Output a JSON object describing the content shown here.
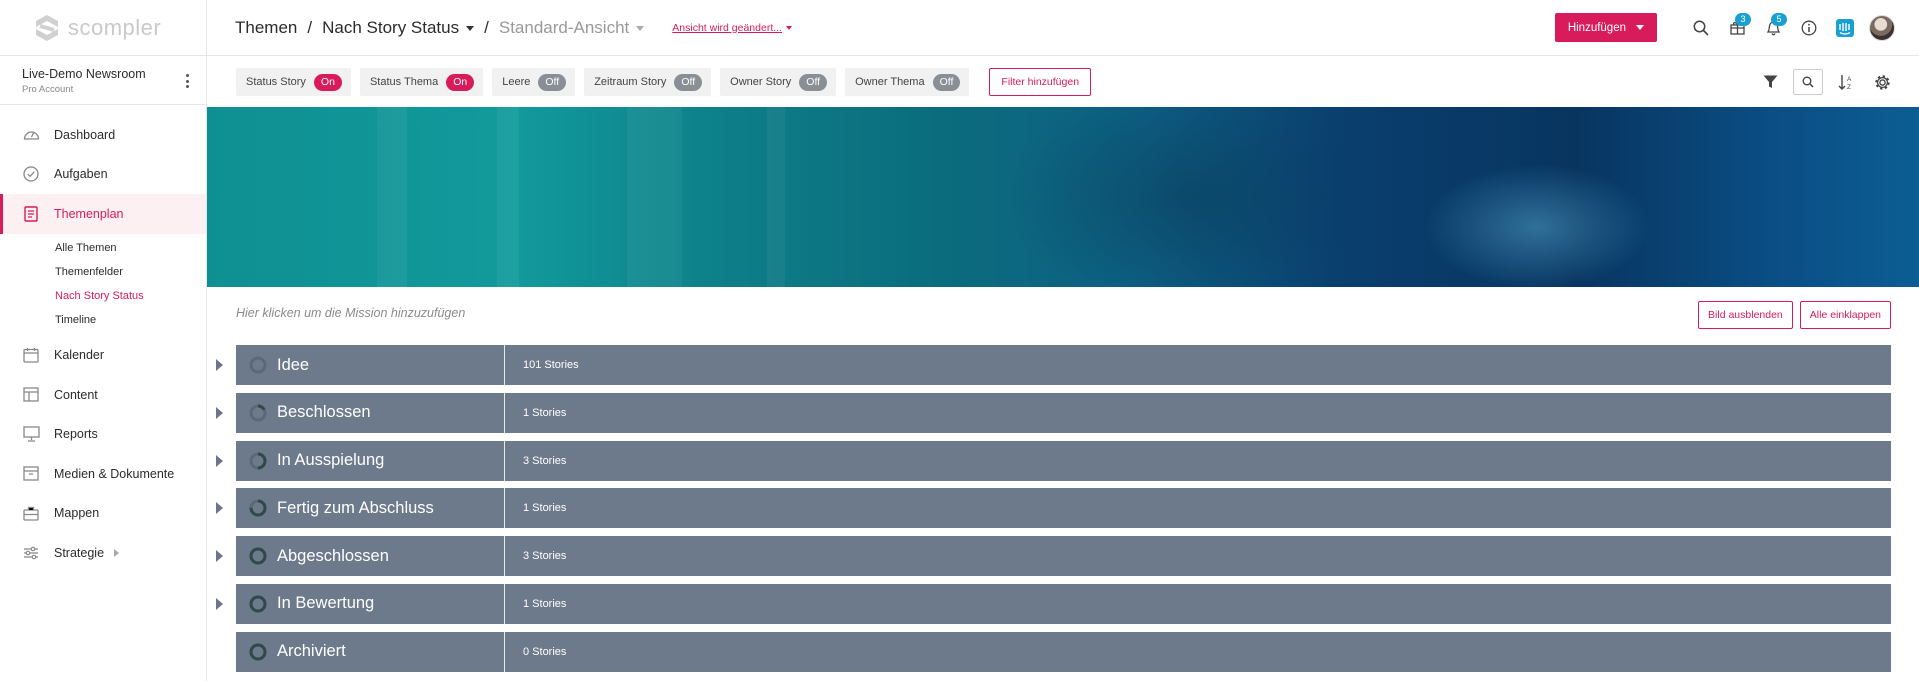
{
  "app": {
    "logo_text": "scompler"
  },
  "account": {
    "name": "Live-Demo Newsroom",
    "plan": "Pro Account"
  },
  "nav": {
    "items": [
      {
        "label": "Dashboard",
        "icon": "gauge-icon"
      },
      {
        "label": "Aufgaben",
        "icon": "check-circle-icon"
      },
      {
        "label": "Themenplan",
        "icon": "document-icon"
      },
      {
        "label": "Kalender",
        "icon": "calendar-icon"
      },
      {
        "label": "Content",
        "icon": "layout-icon"
      },
      {
        "label": "Reports",
        "icon": "monitor-icon"
      },
      {
        "label": "Medien & Dokumente",
        "icon": "archive-icon"
      },
      {
        "label": "Mappen",
        "icon": "briefcase-icon"
      },
      {
        "label": "Strategie",
        "icon": "sliders-icon"
      }
    ],
    "sub_items": [
      "Alle Themen",
      "Themenfelder",
      "Nach Story Status",
      "Timeline"
    ]
  },
  "header": {
    "crumb1": "Themen",
    "crumb2": "Nach Story Status",
    "crumb3": "Standard-Ansicht",
    "sep": "/",
    "view_changed": "Ansicht wird geändert...",
    "add_label": "Hinzufügen",
    "badge_updates": "3",
    "badge_notifications": "5"
  },
  "filters": [
    {
      "label": "Status Story",
      "state": "On"
    },
    {
      "label": "Status Thema",
      "state": "On"
    },
    {
      "label": "Leere",
      "state": "Off"
    },
    {
      "label": "Zeitraum Story",
      "state": "Off"
    },
    {
      "label": "Owner Story",
      "state": "Off"
    },
    {
      "label": "Owner Thema",
      "state": "Off"
    }
  ],
  "filter_add_label": "Filter hinzufügen",
  "mission": {
    "placeholder": "Hier klicken um die Mission hinzuzufügen",
    "hide_image_label": "Bild ausblenden",
    "collapse_all_label": "Alle einklappen"
  },
  "groups": [
    {
      "title": "Idee",
      "count": "101 Stories",
      "progress": 0
    },
    {
      "title": "Beschlossen",
      "count": "1 Stories",
      "progress": 0.17
    },
    {
      "title": "In Ausspielung",
      "count": "3 Stories",
      "progress": 0.5
    },
    {
      "title": "Fertig zum Abschluss",
      "count": "1 Stories",
      "progress": 0.75
    },
    {
      "title": "Abgeschlossen",
      "count": "3 Stories",
      "progress": 1
    },
    {
      "title": "In Bewertung",
      "count": "1 Stories",
      "progress": 1
    },
    {
      "title": "Archiviert",
      "count": "0 Stories",
      "progress": 1
    }
  ],
  "colors": {
    "accent": "#d81b5b",
    "group_bg": "#6d7a8c",
    "badge": "#1a9fd1",
    "ring": "#2f4a46"
  }
}
